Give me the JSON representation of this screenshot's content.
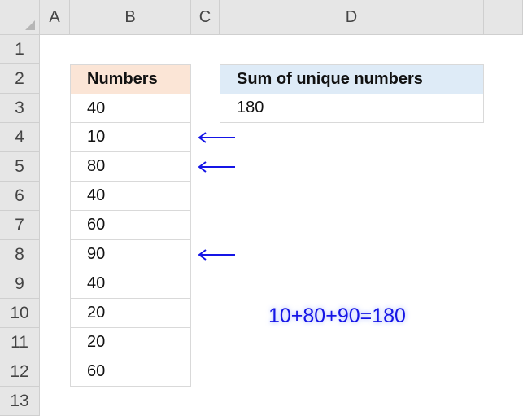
{
  "columns": [
    "A",
    "B",
    "C",
    "D"
  ],
  "rows": [
    "1",
    "2",
    "3",
    "4",
    "5",
    "6",
    "7",
    "8",
    "9",
    "10",
    "11",
    "12",
    "13"
  ],
  "table_b": {
    "header": "Numbers",
    "values": [
      "40",
      "10",
      "80",
      "40",
      "60",
      "90",
      "40",
      "20",
      "20",
      "60"
    ]
  },
  "table_d": {
    "header": "Sum of unique numbers",
    "value": "180"
  },
  "annotation": "10+80+90=180",
  "colors": {
    "b_header_fill": "#fbe5d6",
    "d_header_fill": "#deebf7",
    "arrow": "#1515e6"
  }
}
